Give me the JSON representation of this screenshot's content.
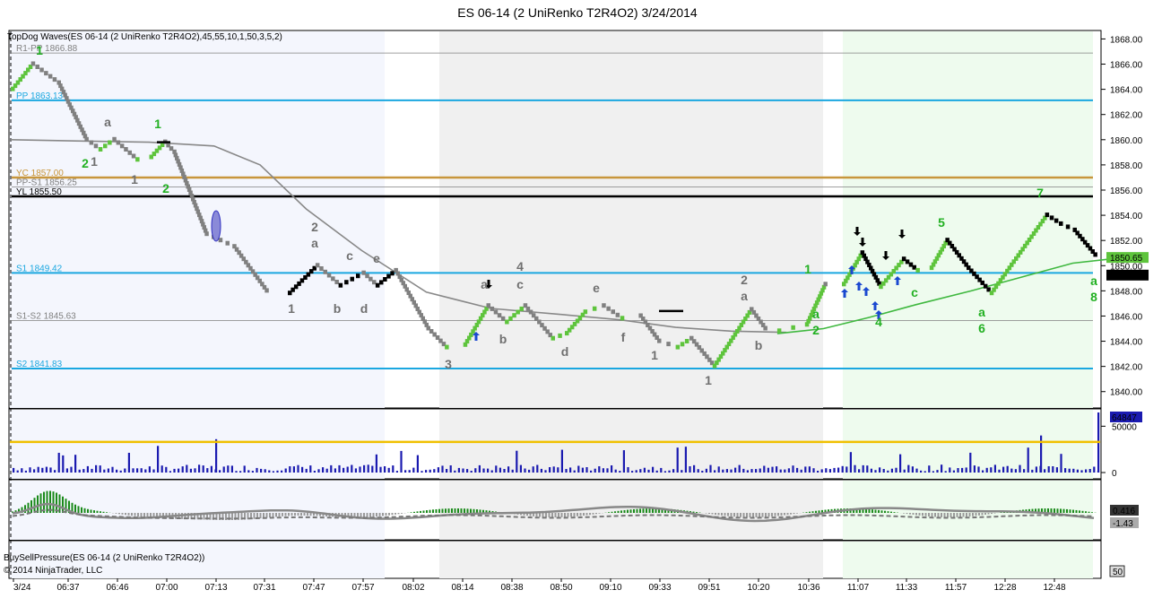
{
  "title": "ES 06-14 (2 UniRenko T2R4O2)  3/24/2014",
  "indicator_label": "TopDog Waves(ES 06-14 (2 UniRenko T2R4O2),45,55,10,1,50,3,5,2)",
  "lower_indicator_label": "BuySellPressure(ES 06-14 (2 UniRenko T2R4O2))",
  "copyright": "© 2014 NinjaTrader, LLC",
  "colors": {
    "up_brick": "#5ec43c",
    "down_brick": "#000000",
    "neutral_brick": "#808080",
    "pivot_line": "#1aa7e0",
    "yc_line": "#c8963c",
    "label_green": "#22b022",
    "label_gray": "#707070",
    "volume_bar": "#1a1ab0",
    "volume_avg": "#f0c000"
  },
  "chart_data": {
    "type": "renko",
    "x_ticks": [
      "3/24",
      "06:37",
      "06:46",
      "07:00",
      "07:13",
      "07:31",
      "07:47",
      "07:57",
      "08:02",
      "08:14",
      "08:38",
      "08:50",
      "09:10",
      "09:33",
      "09:51",
      "10:20",
      "10:36",
      "11:07",
      "11:33",
      "11:57",
      "12:28",
      "12:48"
    ],
    "y_ticks": [
      "1868.00",
      "1866.00",
      "1864.00",
      "1862.00",
      "1860.00",
      "1858.00",
      "1856.00",
      "1854.00",
      "1852.00",
      "1850.00",
      "1848.00",
      "1846.00",
      "1844.00",
      "1842.00",
      "1840.00"
    ],
    "ylim": [
      1838.7,
      1868.6
    ],
    "levels": [
      {
        "label": "R1-PP 1866.88",
        "value": 1866.88,
        "color": "gray"
      },
      {
        "label": "PP 1863.13",
        "value": 1863.13,
        "color": "blue"
      },
      {
        "label": "YC 1857.00",
        "value": 1857.0,
        "color": "orange"
      },
      {
        "label": "PP-S1 1856.25",
        "value": 1856.25,
        "color": "gray"
      },
      {
        "label": "YL 1855.50",
        "value": 1855.5,
        "color": "black"
      },
      {
        "label": "S1 1849.42",
        "value": 1849.42,
        "color": "blue"
      },
      {
        "label": "S1-S2 1845.63",
        "value": 1845.63,
        "color": "gray"
      },
      {
        "label": "S2 1841.83",
        "value": 1841.83,
        "color": "blue"
      }
    ],
    "price_path": [
      [
        0,
        1864.0
      ],
      [
        0.022,
        1866.0
      ],
      [
        0.05,
        1864.5
      ],
      [
        0.08,
        1860.0
      ],
      [
        0.095,
        1859.2
      ],
      [
        0.11,
        1860.0
      ],
      [
        0.135,
        1858.4
      ],
      [
        0.15,
        1858.6
      ],
      [
        0.165,
        1859.8
      ],
      [
        0.175,
        1859.0
      ],
      [
        0.21,
        1852.5
      ],
      [
        0.24,
        1851.5
      ],
      [
        0.275,
        1848.0
      ],
      [
        0.3,
        1847.8
      ],
      [
        0.33,
        1850.0
      ],
      [
        0.355,
        1848.4
      ],
      [
        0.38,
        1849.4
      ],
      [
        0.395,
        1848.4
      ],
      [
        0.415,
        1849.6
      ],
      [
        0.45,
        1845.0
      ],
      [
        0.47,
        1843.5
      ],
      [
        0.49,
        1843.7
      ],
      [
        0.515,
        1846.8
      ],
      [
        0.535,
        1845.5
      ],
      [
        0.555,
        1846.8
      ],
      [
        0.585,
        1844.2
      ],
      [
        0.6,
        1844.6
      ],
      [
        0.62,
        1846.3
      ],
      [
        0.64,
        1846.8
      ],
      [
        0.66,
        1845.8
      ],
      [
        0.68,
        1846.0
      ],
      [
        0.7,
        1844.0
      ],
      [
        0.72,
        1843.5
      ],
      [
        0.735,
        1844.2
      ],
      [
        0.76,
        1842.0
      ],
      [
        0.8,
        1846.5
      ],
      [
        0.815,
        1845.0
      ],
      [
        0.83,
        1844.8
      ],
      [
        0.86,
        1845.3
      ],
      [
        0.88,
        1848.5
      ],
      [
        0.9,
        1848.5
      ],
      [
        0.92,
        1851.0
      ],
      [
        0.94,
        1848.3
      ],
      [
        0.965,
        1850.5
      ],
      [
        0.98,
        1849.6
      ],
      [
        0.995,
        1849.8
      ],
      [
        1.012,
        1852.0
      ],
      [
        1.035,
        1849.8
      ],
      [
        1.05,
        1848.6
      ],
      [
        1.06,
        1847.8
      ],
      [
        1.12,
        1854.0
      ],
      [
        1.135,
        1853.3
      ],
      [
        1.15,
        1852.8
      ],
      [
        1.175,
        1850.6
      ]
    ],
    "fast_ma": [
      [
        0,
        1860.0
      ],
      [
        0.07,
        1859.9
      ],
      [
        0.15,
        1859.8
      ],
      [
        0.22,
        1859.5
      ],
      [
        0.27,
        1858.0
      ],
      [
        0.32,
        1854.5
      ],
      [
        0.38,
        1851.2
      ],
      [
        0.45,
        1847.9
      ],
      [
        0.52,
        1846.6
      ],
      [
        0.6,
        1846.1
      ],
      [
        0.66,
        1845.7
      ],
      [
        0.72,
        1845.1
      ],
      [
        0.78,
        1844.8
      ],
      [
        0.84,
        1844.7
      ]
    ],
    "slow_ma": [
      [
        0.83,
        1844.6
      ],
      [
        0.88,
        1845.0
      ],
      [
        0.93,
        1845.9
      ],
      [
        0.98,
        1846.9
      ],
      [
        1.04,
        1848.0
      ],
      [
        1.1,
        1849.2
      ],
      [
        1.15,
        1850.2
      ],
      [
        1.2,
        1850.6
      ]
    ],
    "volume_max": 64847,
    "volume_ticks": [
      "50000",
      "0"
    ],
    "volume_avg": 33000,
    "pressure_ticks": [
      "0.416",
      "-1.43"
    ],
    "oscillator_label": "50",
    "price_tags": [
      "1850.65",
      "1849.25"
    ],
    "wave_labels": [
      {
        "t": "1",
        "x": 44,
        "y": 61,
        "c": "green"
      },
      {
        "t": "2",
        "x": 95,
        "y": 187,
        "c": "green"
      },
      {
        "t": "1",
        "x": 105,
        "y": 185,
        "c": "gray"
      },
      {
        "t": "a",
        "x": 120,
        "y": 141,
        "c": "gray"
      },
      {
        "t": "1",
        "x": 150,
        "y": 205,
        "c": "gray"
      },
      {
        "t": "1",
        "x": 176,
        "y": 143,
        "c": "green"
      },
      {
        "t": "2",
        "x": 185,
        "y": 215,
        "c": "green"
      },
      {
        "t": "2",
        "x": 351,
        "y": 258,
        "c": "gray"
      },
      {
        "t": "a",
        "x": 351,
        "y": 276,
        "c": "gray"
      },
      {
        "t": "c",
        "x": 390,
        "y": 290,
        "c": "gray"
      },
      {
        "t": "e",
        "x": 420,
        "y": 293,
        "c": "gray"
      },
      {
        "t": "1",
        "x": 325,
        "y": 349,
        "c": "gray"
      },
      {
        "t": "b",
        "x": 376,
        "y": 349,
        "c": "gray"
      },
      {
        "t": "d",
        "x": 406,
        "y": 349,
        "c": "gray"
      },
      {
        "t": "3",
        "x": 500,
        "y": 411,
        "c": "gray"
      },
      {
        "t": "a",
        "x": 540,
        "y": 322,
        "c": "gray"
      },
      {
        "t": "4",
        "x": 580,
        "y": 302,
        "c": "gray"
      },
      {
        "t": "c",
        "x": 580,
        "y": 322,
        "c": "gray"
      },
      {
        "t": "b",
        "x": 561,
        "y": 383,
        "c": "gray"
      },
      {
        "t": "e",
        "x": 665,
        "y": 326,
        "c": "gray"
      },
      {
        "t": "d",
        "x": 630,
        "y": 397,
        "c": "gray"
      },
      {
        "t": "f",
        "x": 695,
        "y": 381,
        "c": "gray"
      },
      {
        "t": "1",
        "x": 730,
        "y": 401,
        "c": "gray"
      },
      {
        "t": "1",
        "x": 790,
        "y": 429,
        "c": "gray"
      },
      {
        "t": "2",
        "x": 830,
        "y": 317,
        "c": "gray"
      },
      {
        "t": "a",
        "x": 830,
        "y": 335,
        "c": "gray"
      },
      {
        "t": "b",
        "x": 846,
        "y": 390,
        "c": "gray"
      },
      {
        "t": "1",
        "x": 901,
        "y": 305,
        "c": "green"
      },
      {
        "t": "a",
        "x": 910,
        "y": 355,
        "c": "green"
      },
      {
        "t": "2",
        "x": 910,
        "y": 373,
        "c": "green"
      },
      {
        "t": "4",
        "x": 980,
        "y": 364,
        "c": "green"
      },
      {
        "t": "c",
        "x": 1020,
        "y": 331,
        "c": "green"
      },
      {
        "t": "5",
        "x": 1050,
        "y": 253,
        "c": "green"
      },
      {
        "t": "a",
        "x": 1095,
        "y": 353,
        "c": "green"
      },
      {
        "t": "6",
        "x": 1095,
        "y": 371,
        "c": "green"
      },
      {
        "t": "7",
        "x": 1160,
        "y": 220,
        "c": "green"
      },
      {
        "t": "a",
        "x": 1220,
        "y": 318,
        "c": "green"
      },
      {
        "t": "8",
        "x": 1220,
        "y": 336,
        "c": "green"
      }
    ]
  }
}
